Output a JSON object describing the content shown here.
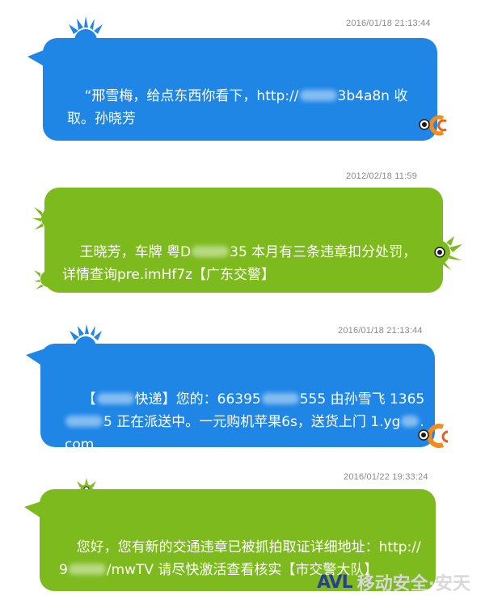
{
  "messages": [
    {
      "timestamp": "2016/01/18  21:13:44",
      "color": "blue",
      "parts": [
        "“邢雪梅，给点东西你看下，http://",
        "[redacted]",
        "3b4a8n 收取。孙晓芳"
      ]
    },
    {
      "timestamp": "2012/02/18  11:59",
      "color": "green",
      "parts": [
        "王晓芳，车牌 粤D",
        "[redacted]",
        "35 本月有三条违章扣分处罚，详情查询pre.imHf7z【广东交警】"
      ]
    },
    {
      "timestamp": "2016/01/18  21:13:44",
      "color": "blue",
      "parts": [
        "【",
        "[redacted]",
        "快递】您的：66395",
        "[redacted]",
        "555 由孙雪飞 1365",
        "[redacted]",
        "5 正在派送中。一元购机苹果6s，送货上门 1.yg",
        "[redacted]",
        ".com"
      ]
    },
    {
      "timestamp": "2016/01/22  19:33:24",
      "color": "green",
      "parts": [
        "您好，您有新的交通违章已被抓拍取证详细地址：http://9",
        "[redacted]",
        "/mwTV 请尽快激活查看核实【市交警大队】"
      ]
    }
  ],
  "watermark": {
    "logo": "AVL",
    "text": "移动安全·安天"
  },
  "colors": {
    "blue": "#1f86e6",
    "green": "#7dba1e",
    "timestamp": "#8a8a8a"
  }
}
